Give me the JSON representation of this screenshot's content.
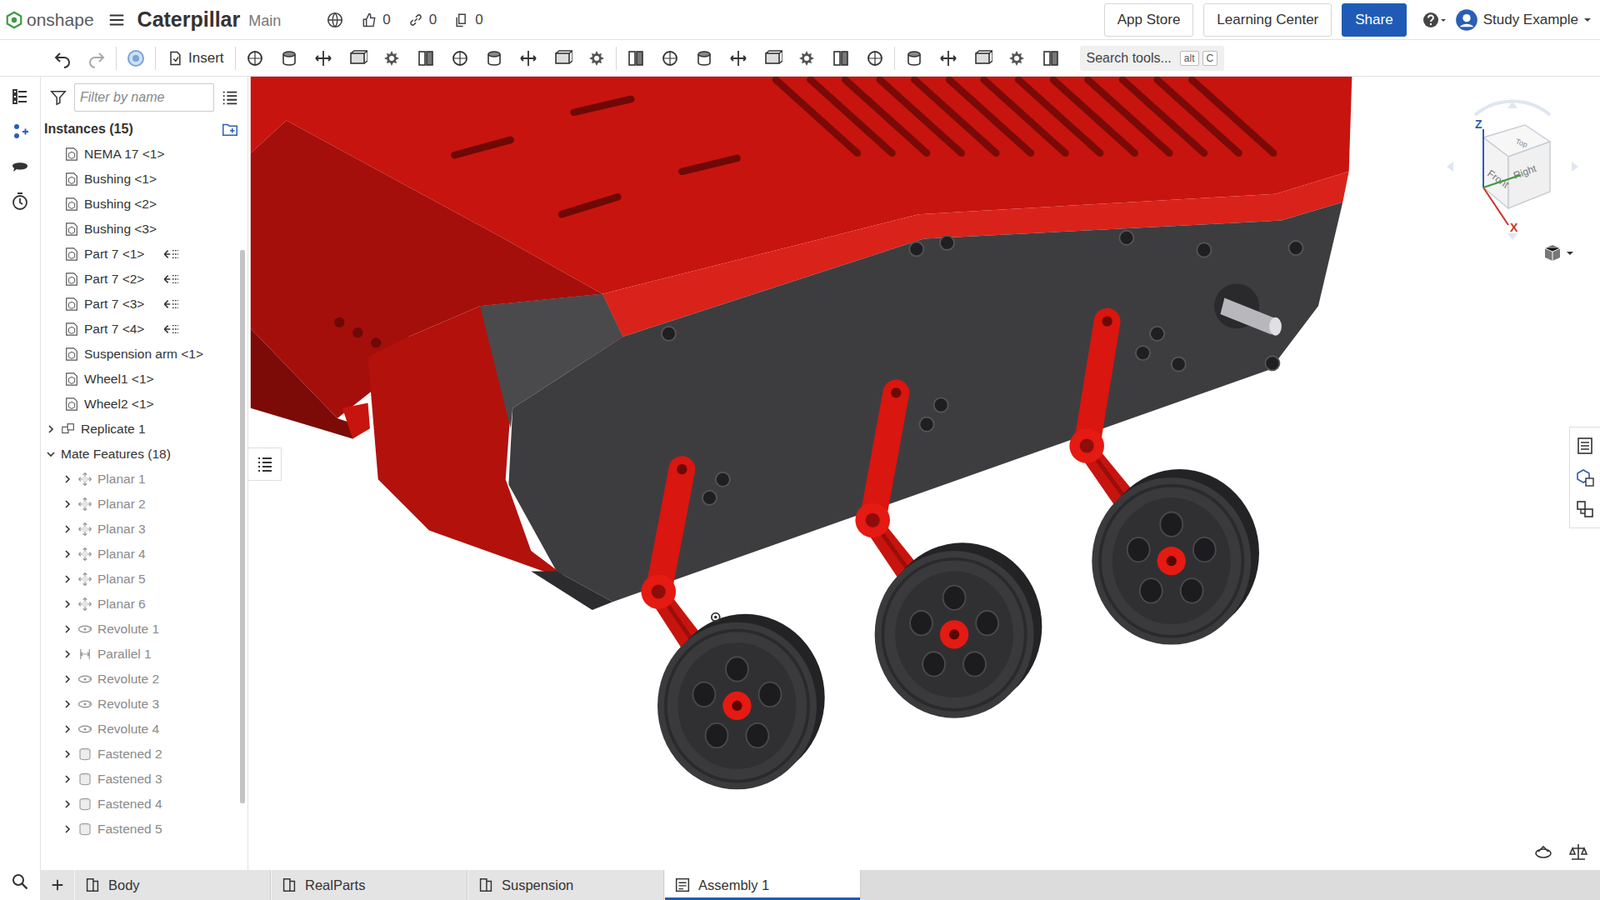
{
  "header": {
    "logo": "onshape",
    "title": "Caterpillar",
    "branch": "Main",
    "likes": "0",
    "links": "0",
    "copies": "0",
    "buttons": [
      {
        "label": "App Store",
        "primary": false
      },
      {
        "label": "Learning Center",
        "primary": false
      },
      {
        "label": "Share",
        "primary": true
      }
    ],
    "user": "Study Example"
  },
  "toolbar": {
    "insert": "Insert",
    "search": {
      "placeholder": "Search tools...",
      "keys": [
        "alt",
        "C"
      ]
    }
  },
  "panel": {
    "filter_placeholder": "Filter by name",
    "instances": {
      "label": "Instances (15)",
      "items": [
        {
          "name": "NEMA 17 <1>",
          "mated": false
        },
        {
          "name": "Bushing <1>",
          "mated": false
        },
        {
          "name": "Bushing <2>",
          "mated": false
        },
        {
          "name": "Bushing <3>",
          "mated": false
        },
        {
          "name": "Part 7 <1>",
          "mated": true
        },
        {
          "name": "Part 7 <2>",
          "mated": true
        },
        {
          "name": "Part 7 <3>",
          "mated": true
        },
        {
          "name": "Part 7 <4>",
          "mated": true
        },
        {
          "name": "Suspension arm <1>",
          "mated": false
        },
        {
          "name": "Wheel1 <1>",
          "mated": false
        },
        {
          "name": "Wheel2 <1>",
          "mated": false
        }
      ]
    },
    "replicate": {
      "label": "Replicate 1",
      "expanded": false
    },
    "mates": {
      "label": "Mate Features (18)",
      "expanded": true,
      "items": [
        {
          "name": "Planar 1",
          "kind": "planar",
          "greyed": true
        },
        {
          "name": "Planar 2",
          "kind": "planar",
          "greyed": true
        },
        {
          "name": "Planar 3",
          "kind": "planar",
          "greyed": true
        },
        {
          "name": "Planar 4",
          "kind": "planar",
          "greyed": true
        },
        {
          "name": "Planar 5",
          "kind": "planar",
          "greyed": true
        },
        {
          "name": "Planar 6",
          "kind": "planar",
          "greyed": true
        },
        {
          "name": "Revolute 1",
          "kind": "revolute",
          "greyed": true
        },
        {
          "name": "Parallel 1",
          "kind": "parallel",
          "greyed": true
        },
        {
          "name": "Revolute 2",
          "kind": "revolute",
          "greyed": true
        },
        {
          "name": "Revolute 3",
          "kind": "revolute",
          "greyed": true
        },
        {
          "name": "Revolute 4",
          "kind": "revolute",
          "greyed": true
        },
        {
          "name": "Fastened 2",
          "kind": "fastened",
          "greyed": true
        },
        {
          "name": "Fastened 3",
          "kind": "fastened",
          "greyed": true
        },
        {
          "name": "Fastened 4",
          "kind": "fastened",
          "greyed": true
        },
        {
          "name": "Fastened 5",
          "kind": "fastened",
          "greyed": true
        }
      ]
    }
  },
  "viewcube": {
    "faces": [
      "Front",
      "Right",
      "Top"
    ],
    "axes": [
      "Z",
      "X"
    ]
  },
  "tabs": [
    {
      "label": "Body",
      "selected": false
    },
    {
      "label": "RealParts",
      "selected": false
    },
    {
      "label": "Suspension",
      "selected": false
    },
    {
      "label": "Assembly 1",
      "selected": true
    }
  ]
}
